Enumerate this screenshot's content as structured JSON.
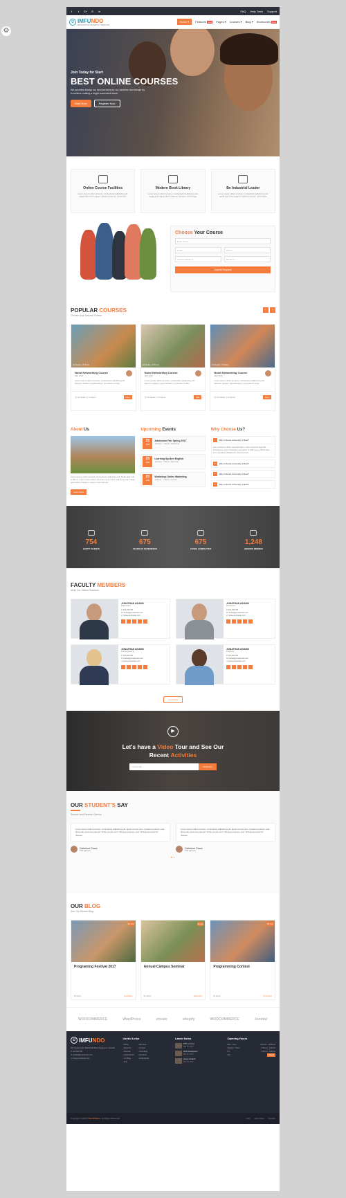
{
  "settings_icon": "gear-icon",
  "topbar": {
    "social": [
      "f",
      "t",
      "G+",
      "⊙",
      "in"
    ],
    "links": [
      "FAQ",
      "Help Desk",
      "Support"
    ]
  },
  "brand": {
    "name_a": "IMFU",
    "name_b": "NDO",
    "tagline": "EDUCATION & UNIVERSITY TEMPLATE"
  },
  "menu": [
    {
      "label": "Home",
      "active": true
    },
    {
      "label": "Features",
      "badge": "New"
    },
    {
      "label": "Pages"
    },
    {
      "label": "Courses"
    },
    {
      "label": "Blog"
    },
    {
      "label": "Shortcodes",
      "badge": "New"
    }
  ],
  "hero": {
    "kicker": "Join Today for Start",
    "title": "BEST ONLINE COURSES",
    "text": "We provides always our best services for our students and always try to achieve making a bright successful future.",
    "btn_primary": "Start Now",
    "btn_secondary": "Register Now"
  },
  "features": [
    {
      "title": "Online Course Facilities",
      "text": "Lorem ipsum dolor sit amet, consectetur adipiscing elit. Nulla quis erat in libero natione posuere, accumsan"
    },
    {
      "title": "Modern Book Library",
      "text": "Lorem ipsum dolor sit amet, consectetur adipiscing elit. Nulla quis erat in libero natione posuere, accumsan"
    },
    {
      "title": "Be Industrial Leader",
      "text": "Lorem ipsum dolor sit amet, consectetur adipiscing elit. Nulla quis erat in libero natione posuere, accumsan"
    }
  ],
  "choose": {
    "title_a": "Choose",
    "title_b": "Your Course",
    "name_placeholder": "Enter Name",
    "email_placeholder": "Email",
    "phone_placeholder": "Phone",
    "faculty_placeholder": "Choose Faculty",
    "date_placeholder": "DD M YY",
    "submit": "Submit Request"
  },
  "popular": {
    "title_a": "POPULAR",
    "title_b": "COURSES",
    "subtitle": "Choose your Desired Course",
    "prev": "‹",
    "next": "›",
    "courses": [
      {
        "title": "Nural Networking Course",
        "who": "Jack Smith",
        "meta": "(24 Seats) • (3 Hours)",
        "text": "Lorem ipsum dolor sit amet, consectetur adipiscing elit. Alienum quidem reprehenderit, numquam a soler.",
        "seats": "24 Seats",
        "hours": "3 Hours",
        "price": "Free"
      },
      {
        "title": "Nural Networking Course",
        "who": "Jack Smith",
        "meta": "(24 Seats) • (3 Hours)",
        "text": "Lorem ipsum dolor sit amet, consectetur adipiscing elit. Alienum quidem reprehenderit, numquam a soler.",
        "seats": "24 Seats",
        "hours": "3 Hours",
        "price": "$99"
      },
      {
        "title": "Nural Networking Course",
        "who": "Jack Smith",
        "meta": "(24 Seats) • (3 Hours)",
        "text": "Lorem ipsum dolor sit amet, consectetur adipiscing elit. Alienum quidem reprehenderit, numquam a soler.",
        "seats": "24 Seats",
        "hours": "3 Hours",
        "price": "Free"
      }
    ]
  },
  "about": {
    "title_a": "About",
    "title_b": "Us",
    "text": "Lorem ipsum dolor sit amet consectetur adipiscing elit. Nulla quis erat in libero. Lorem ipsum dolor sit amet comp scitur adipiscing elit. Tiluen perforadtg. Pariatur, neque commodi iste.",
    "more": "Learn More"
  },
  "events": {
    "title_a": "Upcoming",
    "title_b": "Events",
    "items": [
      {
        "day": "20",
        "mon": "JUN",
        "title": "Admission Fair Spring 2017",
        "time": "12:00 pm - 7:30 pm • Melbourne"
      },
      {
        "day": "20",
        "mon": "JUN",
        "title": "Learning Spoken English",
        "time": "12:00 pm - 7:30 pm • New York"
      },
      {
        "day": "20",
        "mon": "JUN",
        "title": "Workshop Online Marketing",
        "time": "12:00 pm - 7:30 pm • London"
      }
    ]
  },
  "why": {
    "title_a": "Why Choose",
    "title_b": "Us?",
    "q1": "Why Imfundo University is Best?",
    "a1": "Anim pariatur cliche reprehenderit, enim eiusmod high life accusamus terry richardson ad squid. 3 wolf moon officia aute, non cupidatat skateboard dolor brunch.",
    "q2": "Why Imfundo University is Best?",
    "q3": "Why Imfundo University is Best?",
    "q4": "Why Imfundo University is Best?"
  },
  "stats": [
    {
      "num": "754",
      "label": "HAPPY CLIENTS"
    },
    {
      "num": "675",
      "label": "YEARS OF EXPERIENCE"
    },
    {
      "num": "675",
      "label": "CASES COMPLETED"
    },
    {
      "num": "1,248",
      "label": "AWARDS WINNING"
    }
  ],
  "faculty": {
    "title_a": "FACULTY",
    "title_b": "MEMBERS",
    "subtitle": "Meet Our Skilled Teachers",
    "load": "Load More",
    "members": [
      {
        "name": "JONATHAN ADAMS",
        "role": "Mathematics",
        "phone": "123-456-789",
        "email": "contact@yourdomain.com",
        "web": "www.yourdomain.com"
      },
      {
        "name": "JONATHAN ADAMS",
        "role": "Architecture",
        "phone": "123-456-789",
        "email": "contact@yourdomain.com",
        "web": "www.yourdomain.com"
      },
      {
        "name": "JONATHAN ADAMS",
        "role": "Civil Engineering",
        "phone": "123-456-789",
        "email": "contact@yourdomain.com",
        "web": "www.yourdomain.com"
      },
      {
        "name": "JONATHAN ADAMS",
        "role": "Chemistry",
        "phone": "123-456-789",
        "email": "contact@yourdomain.com",
        "web": "www.yourdomain.com"
      }
    ]
  },
  "video": {
    "l1a": "Let's have a",
    "l1b": "Video",
    "l1c": "Tour and See Our",
    "l2a": "Recent",
    "l2b": "Activities",
    "email_placeholder": "Your Email",
    "subscribe": "Subscribe"
  },
  "testimonials": {
    "title_a": "OUR",
    "title_b": "STUDENT'S",
    "title_c": "SAY",
    "subtitle": "Student and Parents Opinion",
    "items": [
      {
        "quote": "Lorem ipsum dolor sit amet, consectetur adipiscing elit. Quas vel sint sem. Quisque posuere erat. Quisquat possimus placeat. Quas vel sint sem. Quisque posuere erat. Quisquat possimus placeat.",
        "name": "Catherine Grace",
        "role": "CSE applicant"
      },
      {
        "quote": "Lorem ipsum dolor sit amet, consectetur adipiscing elit. Quas vel sint sem. Quisque posuere erat. Quisquat possimus placeat. Quas vel sint sem. Quisque posuere erat. Quisquat possimus placeat.",
        "name": "Catherine Grace",
        "role": "CSE applicant"
      }
    ]
  },
  "blog": {
    "title_a": "OUR",
    "title_b": "BLOG",
    "subtitle": "See Our Recent Blog",
    "posts": [
      {
        "title": "Programing Festival 2017",
        "date": "20 Jun",
        "author": "By Admin",
        "more": "Read More"
      },
      {
        "title": "Annual Campus Seminar",
        "date": "20 Jun",
        "author": "By Admin",
        "more": "Read More"
      },
      {
        "title": "Programming Contest",
        "date": "20 Jun",
        "author": "By Admin",
        "more": "Read More"
      }
    ]
  },
  "partners": [
    "WOOCOMMERCE",
    "WordPress",
    "envato",
    "shopify",
    "WOOCOMMERCE",
    "Joomla!"
  ],
  "footer": {
    "address": "203, Envato Labs, Behind Alis Steet, Melbourne, Australia",
    "phone": "123-456-789",
    "email": "contact@yourdomain.com",
    "web": "www.yourdomain.com",
    "useful_title": "Useful Links",
    "useful_a": [
      "Home",
      "About Us",
      "Services",
      "Latest Works",
      "Our Blog",
      "FAQ"
    ],
    "useful_b": [
      "Business",
      "Finance",
      "Consulting",
      "Insurance",
      "Professional"
    ],
    "news_title": "Latest News",
    "news": [
      {
        "title": "PHP Learning",
        "date": "Mar 06, 2017"
      },
      {
        "title": "Web Development",
        "date": "Mar 06, 2017"
      },
      {
        "title": "Spoken English",
        "date": "Mar 06, 2017"
      }
    ],
    "hours_title": "Opening Hours",
    "hours": [
      {
        "d": "Mon - Tues :",
        "h": "6:00 am - 10:00 pm"
      },
      {
        "d": "Wednes - Thurs :",
        "h": "8:00 am - 6:00 pm"
      },
      {
        "d": "Fri :",
        "h": "3:00 pm - 8:00 pm"
      },
      {
        "d": "Sun :",
        "h": "Closed"
      }
    ],
    "copy_a": "Copyright © 2018",
    "copy_b": "ThemeMascot",
    "copy_c": ". All Rights Reserved",
    "copy_links": [
      "FAQ",
      "Help Desk",
      "Support"
    ]
  }
}
